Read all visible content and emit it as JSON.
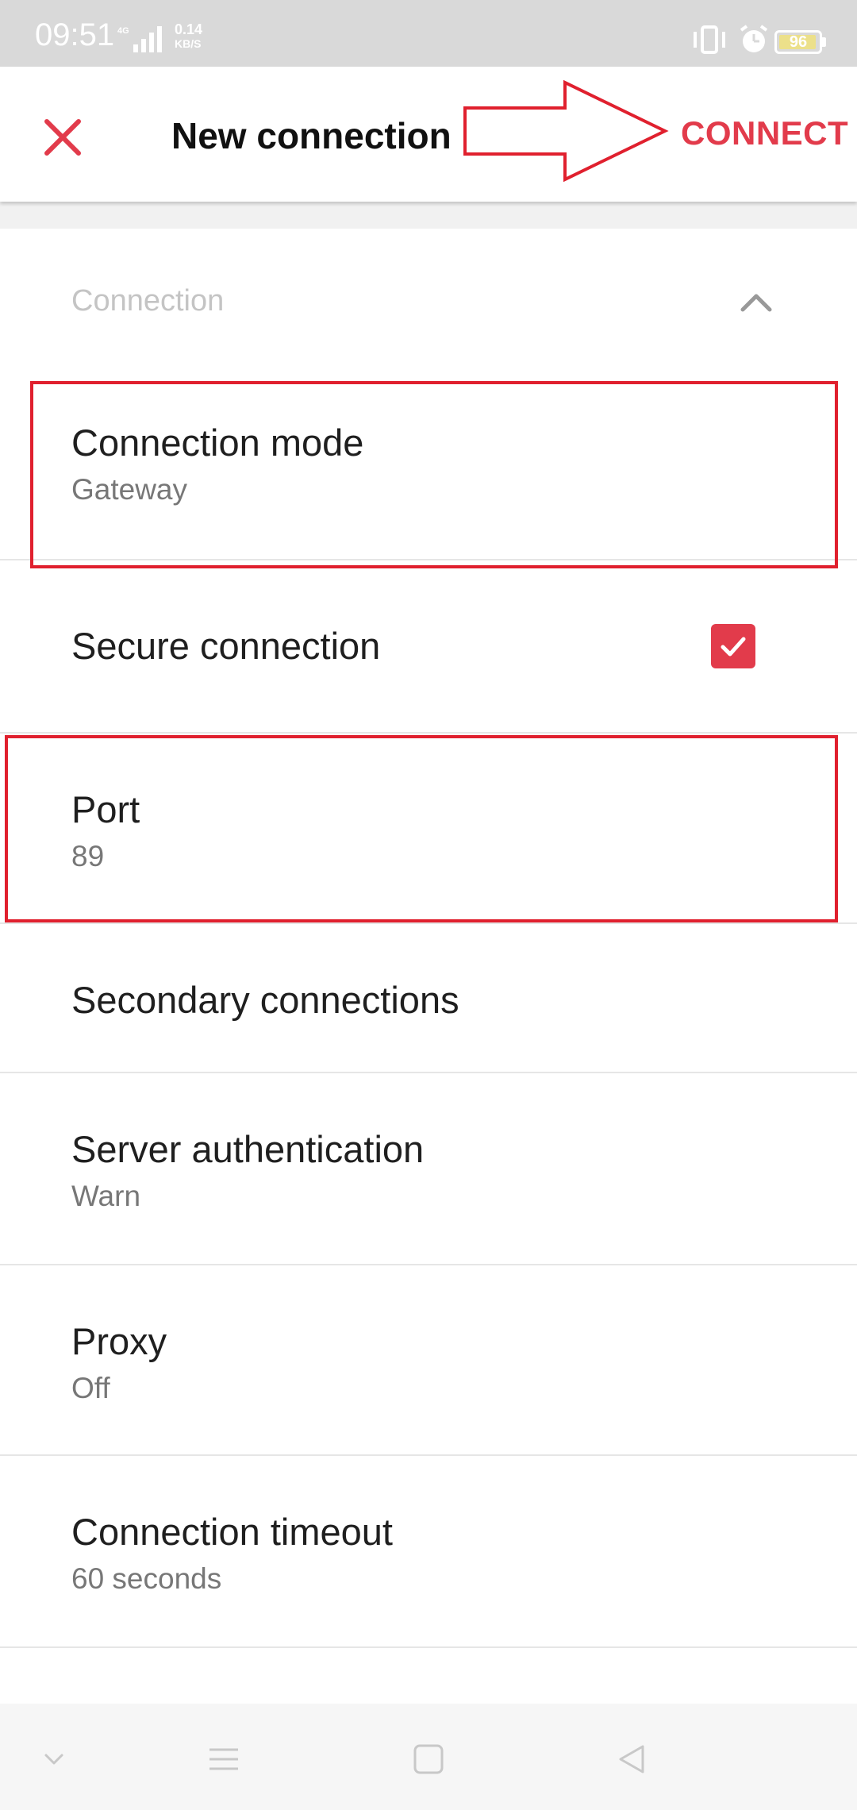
{
  "status_bar": {
    "time": "09:51",
    "network": "4G",
    "speed_value": "0.14",
    "speed_unit": "KB/S",
    "battery": "96",
    "battery_level": 0.96
  },
  "app_bar": {
    "title": "New connection",
    "close_icon": "close-icon",
    "connect_label": "CONNECT"
  },
  "section": {
    "title": "Connection",
    "expanded": true
  },
  "rows": [
    {
      "title": "Connection mode",
      "value": "Gateway"
    },
    {
      "title": "Secure connection",
      "checked": true
    },
    {
      "title": "Port",
      "value": "89"
    },
    {
      "title": "Secondary connections"
    },
    {
      "title": "Server authentication",
      "value": "Warn"
    },
    {
      "title": "Proxy",
      "value": "Off"
    },
    {
      "title": "Connection timeout",
      "value": "60 seconds"
    }
  ],
  "colors": {
    "accent": "#e23b4b",
    "annotation": "#e0202e",
    "status_bar": "#d9d9d9"
  }
}
